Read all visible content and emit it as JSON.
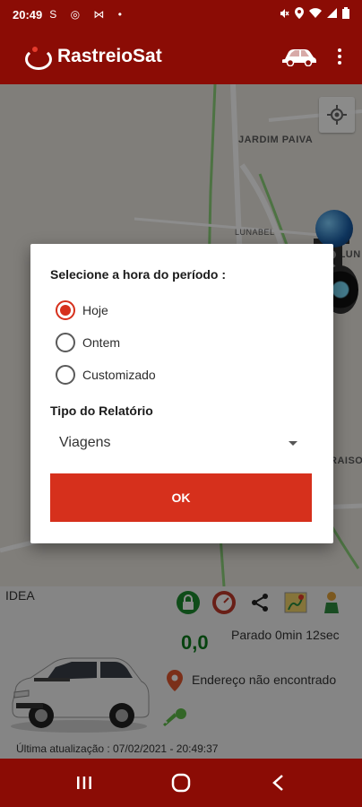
{
  "status_bar": {
    "time": "20:49",
    "left_icons": "S ◎ ⋈ •",
    "right_icons": "🔕 ⚲ ◔ ▮"
  },
  "app_bar": {
    "title": "RastreioSat",
    "car_icon": "car-icon",
    "more_icon": "more-vert-icon"
  },
  "map": {
    "labels": {
      "jardim_paiva": "JARDIM PAIVA",
      "lunabel": "LUNABEL",
      "partial_lun": "L LUN",
      "partial_raiso": "RAISO"
    }
  },
  "dialog": {
    "title": "Selecione a hora do período :",
    "options": [
      {
        "label": "Hoje",
        "checked": true
      },
      {
        "label": "Ontem",
        "checked": false
      },
      {
        "label": "Customizado",
        "checked": false
      }
    ],
    "report_label": "Tipo do Relatório",
    "report_value": "Viagens",
    "ok_label": "OK",
    "accent_color": "#d6301c"
  },
  "vehicle": {
    "name": "IDEA",
    "speed": "0,0",
    "status": "Parado 0min 12sec",
    "address": "Endereço não encontrado",
    "last_update": "Última atualização : 07/02/2021 - 20:49:37"
  },
  "colors": {
    "brand": "#8b0c05",
    "speed": "#0c7a1c"
  }
}
